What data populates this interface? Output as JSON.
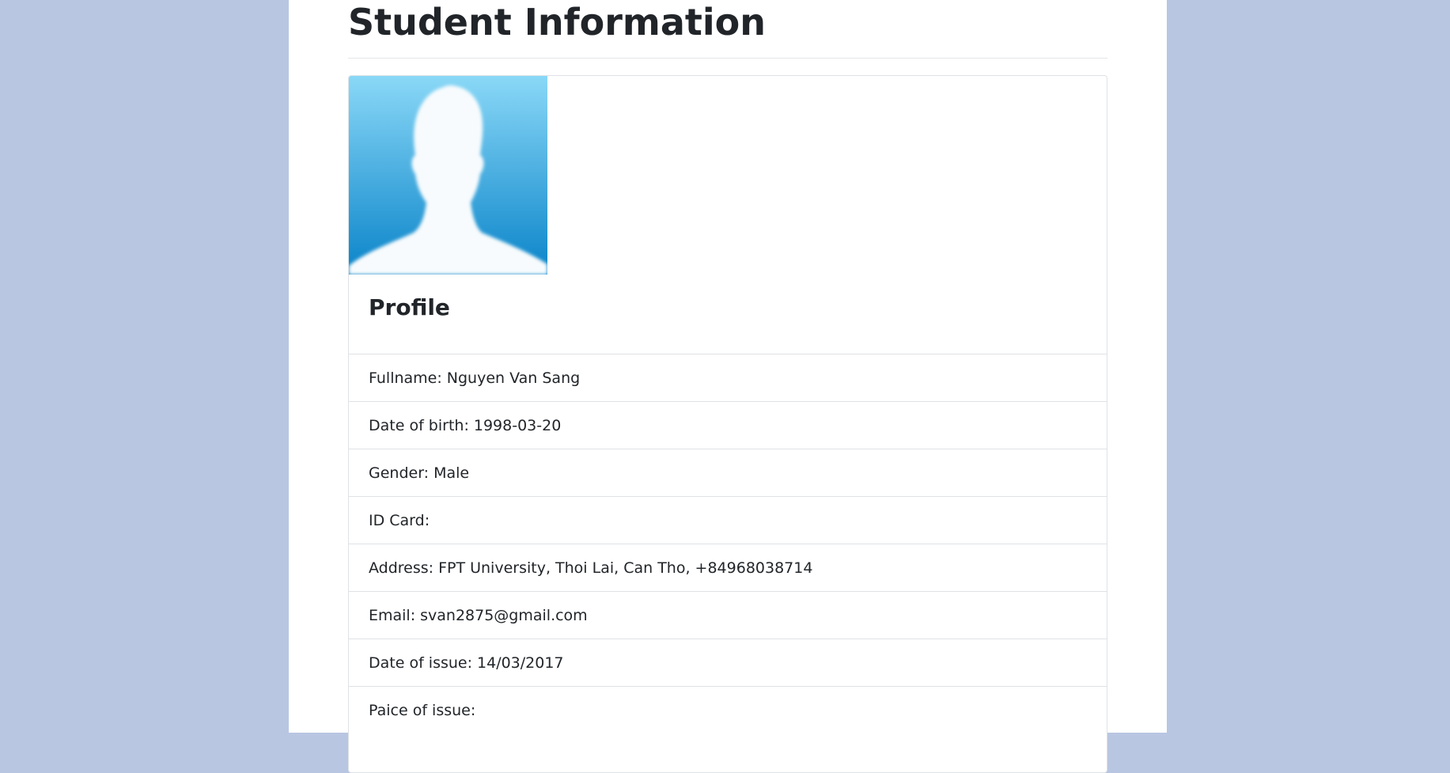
{
  "page": {
    "title": "Student Information"
  },
  "card": {
    "avatar_icon": "person-silhouette-icon",
    "title": "Profile"
  },
  "profile": {
    "items": [
      {
        "label": "Fullname:",
        "value": "Nguyen Van Sang"
      },
      {
        "label": "Date of birth:",
        "value": "1998-03-20"
      },
      {
        "label": "Gender:",
        "value": "Male"
      },
      {
        "label": "ID Card:",
        "value": ""
      },
      {
        "label": "Address:",
        "value": "FPT University, Thoi Lai, Can Tho, +84968038714"
      },
      {
        "label": "Email:",
        "value": "svan2875@gmail.com"
      },
      {
        "label": "Date of issue:",
        "value": "14/03/2017"
      },
      {
        "label": "Paice of issue:",
        "value": ""
      }
    ]
  },
  "colors": {
    "background": "#b9c6e2",
    "panel": "#ffffff",
    "avatar_top": "#8ad8f7",
    "avatar_bottom": "#0a84c9"
  }
}
